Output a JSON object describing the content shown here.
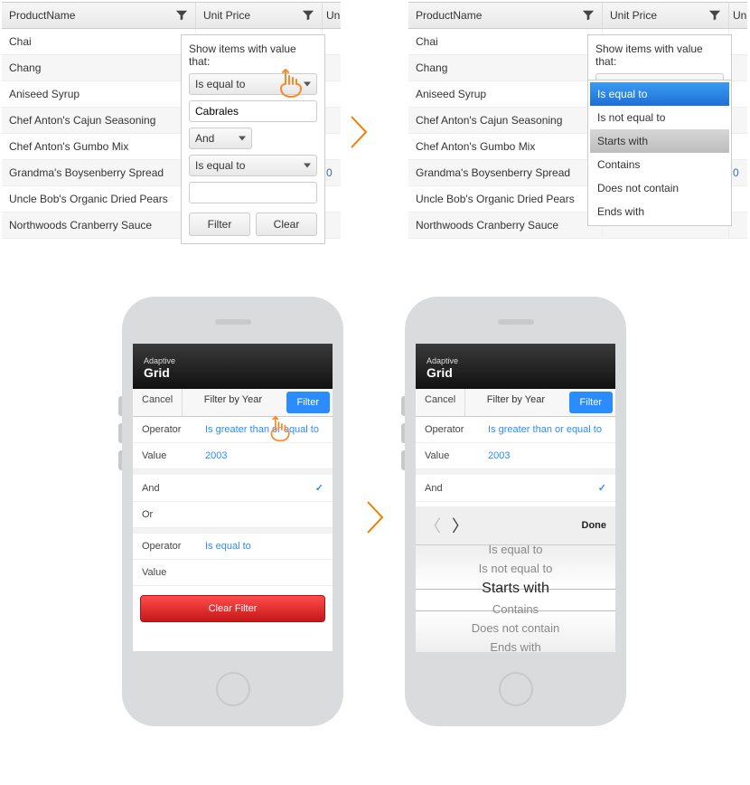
{
  "desktop": {
    "headers": {
      "product": "ProductName",
      "price": "Unit Price",
      "price_clip": "Unit"
    },
    "rows": [
      "Chai",
      "Chang",
      "Aniseed Syrup",
      "Chef Anton's Cajun Seasoning",
      "Chef Anton's Gumbo Mix",
      "Grandma's Boysenberry Spread",
      "Uncle Bob's Organic Dried Pears",
      "Northwoods Cranberry Sauce"
    ],
    "price_peek": "0",
    "filter_menu": {
      "title": "Show items with value that:",
      "op1": "Is equal to",
      "val1": "Cabrales",
      "logic": "And",
      "op2": "Is equal to",
      "val2": "",
      "btn_filter": "Filter",
      "btn_clear": "Clear"
    },
    "dropdown_options": [
      {
        "label": "Is equal to",
        "state": "sel"
      },
      {
        "label": "Is not equal to",
        "state": ""
      },
      {
        "label": "Starts with",
        "state": "hov"
      },
      {
        "label": "Contains",
        "state": ""
      },
      {
        "label": "Does not contain",
        "state": ""
      },
      {
        "label": "Ends with",
        "state": ""
      }
    ]
  },
  "mobile": {
    "header_small": "Adaptive",
    "header_big": "Grid",
    "toolbar": {
      "cancel": "Cancel",
      "title": "Filter by Year",
      "filter": "Filter"
    },
    "rows": {
      "operator_label": "Operator",
      "operator_val1": "Is greater than or equal to",
      "value_label": "Value",
      "value_val1": "2003",
      "logic_and": "And",
      "logic_or": "Or",
      "operator_val2": "Is equal to",
      "value_val2": ""
    },
    "clear_filter": "Clear Filter",
    "picker": {
      "done": "Done",
      "options": [
        "Is equal to",
        "Is not equal to",
        "Starts with",
        "Contains",
        "Does not contain",
        "Ends with"
      ],
      "current": "Starts with"
    }
  }
}
